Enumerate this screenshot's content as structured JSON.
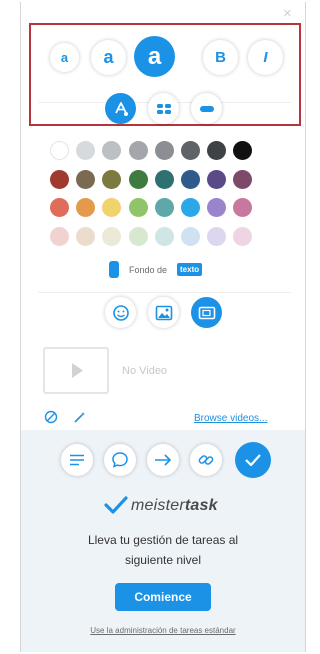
{
  "window": {
    "close_glyph": "×"
  },
  "format_toolbar": {
    "size_small": "a",
    "size_medium": "a",
    "size_large": "a",
    "bold": "B",
    "italic": "I"
  },
  "style_toolbar": {
    "items": [
      {
        "icon": "fill-color-icon",
        "active": true
      },
      {
        "icon": "shape-style-icon",
        "active": false
      },
      {
        "icon": "pill-shape-icon",
        "active": false
      }
    ]
  },
  "palette": {
    "rows": [
      [
        "#ffffff",
        "#d7dadd",
        "#bcc0c4",
        "#a3a7ab",
        "#8b8f93",
        "#5f6368",
        "#3e4246",
        "#111111"
      ],
      [
        "#9e3a2e",
        "#7a6a52",
        "#7b7a3f",
        "#3f7a3f",
        "#2f7070",
        "#2f5b8c",
        "#5a4a88",
        "#7e4a6a"
      ],
      [
        "#e06c5b",
        "#e39a4b",
        "#f0d36b",
        "#8fc46a",
        "#5fa8a8",
        "#2aa8e8",
        "#9a85cc",
        "#c8789f"
      ],
      [
        "#f0d3d0",
        "#ecdccc",
        "#ecead6",
        "#d8e8cf",
        "#cfe6e6",
        "#cfe1f2",
        "#dcd7ef",
        "#efd5e3"
      ]
    ]
  },
  "background_option": {
    "label": "Fondo de",
    "value": "texto"
  },
  "insert_toolbar": {
    "items": [
      {
        "icon": "emoji-icon",
        "active": false
      },
      {
        "icon": "image-icon",
        "active": false
      },
      {
        "icon": "video-icon",
        "active": true
      }
    ]
  },
  "video": {
    "placeholder": "No Video",
    "browse_link": "Browse videos..."
  },
  "action_toolbar": {
    "items": [
      {
        "icon": "align-left-icon",
        "active": false
      },
      {
        "icon": "comment-icon",
        "active": false
      },
      {
        "icon": "arrow-right-icon",
        "active": false
      },
      {
        "icon": "link-icon",
        "active": false
      },
      {
        "icon": "check-icon",
        "active": true
      }
    ]
  },
  "promo": {
    "brand_light": "meister",
    "brand_bold": "task",
    "line1": "Lleva tu gestión de tareas al",
    "line2": "siguiente nivel",
    "button": "Comience",
    "footer_link": "Use la administración de tareas estándar"
  },
  "colors": {
    "accent": "#1b92e6",
    "highlight_box": "#b6343a",
    "lower_bg": "#eef3f8"
  }
}
